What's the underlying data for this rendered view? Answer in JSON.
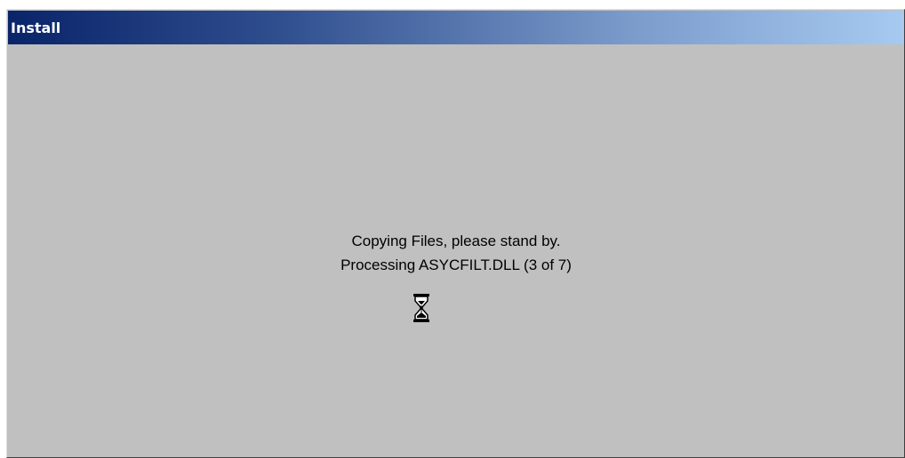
{
  "window": {
    "title": "Install"
  },
  "status": {
    "line1": "Copying Files, please stand by.",
    "line2": "Processing ASYCFILT.DLL (3 of 7)"
  },
  "icons": {
    "busy": "hourglass-icon"
  },
  "colors": {
    "titlebar_start": "#0a246a",
    "titlebar_end": "#a6caf0",
    "window_background": "#c0c0c0",
    "title_text": "#ffffff"
  }
}
